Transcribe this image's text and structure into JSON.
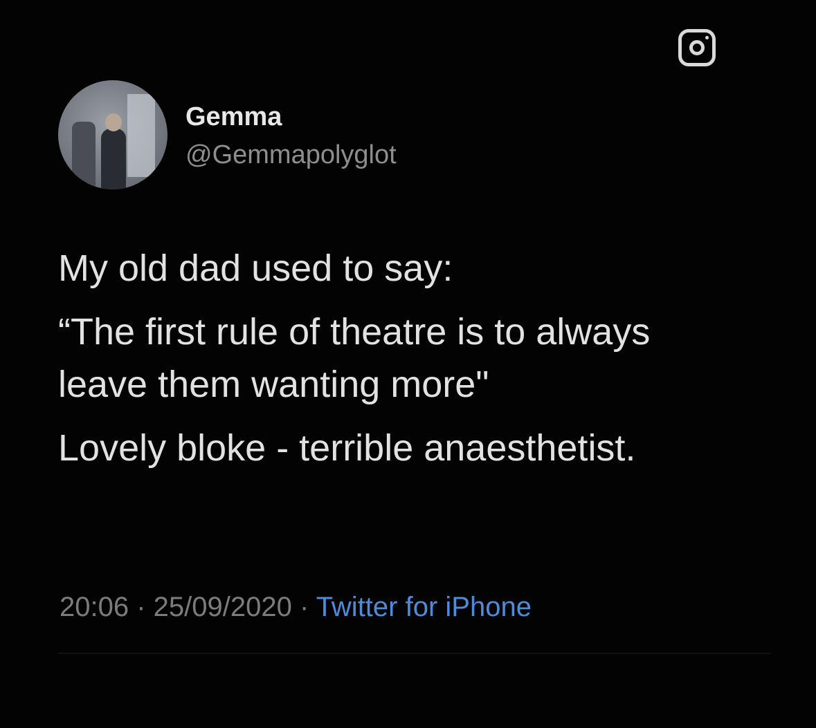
{
  "overlay": {
    "icon": "instagram-icon"
  },
  "author": {
    "name": "Gemma",
    "handle": "@Gemmapolyglot",
    "avatar": "avatar-photo"
  },
  "tweet": {
    "lines": [
      "My old dad used to say:",
      "“The first rule of theatre is to always",
      "leave them wanting more\"",
      "Lovely bloke - terrible anaesthetist."
    ]
  },
  "meta": {
    "time": "20:06",
    "separator": " · ",
    "date": "25/09/2020",
    "source": "Twitter for iPhone"
  },
  "colors": {
    "background": "#030303",
    "text": "#e2e2e2",
    "muted": "#8e8e8e",
    "link": "#4f8bd6"
  }
}
